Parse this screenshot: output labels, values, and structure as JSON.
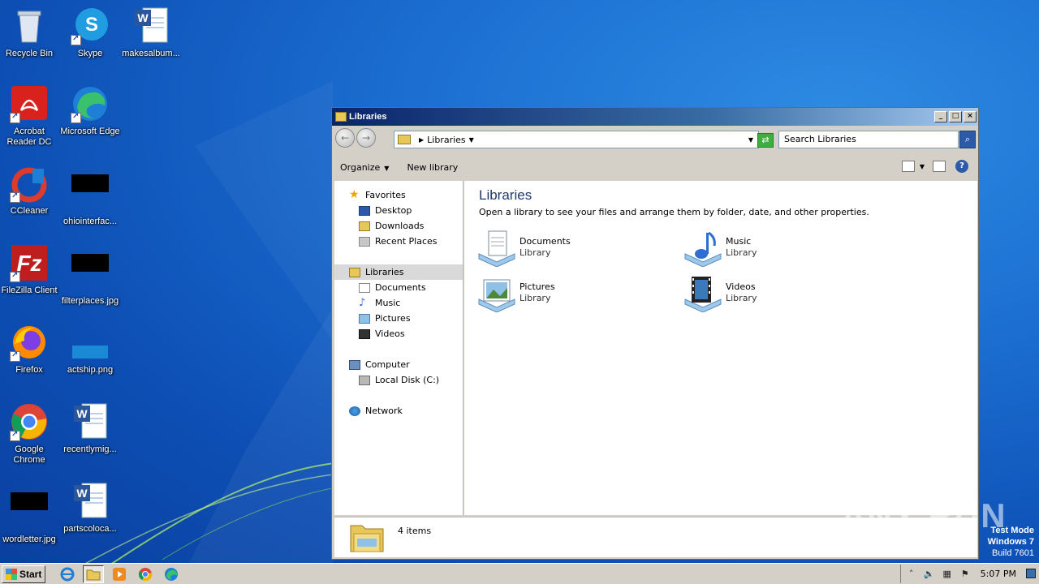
{
  "desktop": {
    "icons": [
      {
        "label": "Recycle Bin"
      },
      {
        "label": "Skype"
      },
      {
        "label": "makesalbum..."
      },
      {
        "label": "Acrobat Reader DC"
      },
      {
        "label": "Microsoft Edge"
      },
      {
        "label": "CCleaner"
      },
      {
        "label": "ohiointerfac..."
      },
      {
        "label": "FileZilla Client"
      },
      {
        "label": "filterplaces.jpg"
      },
      {
        "label": "Firefox"
      },
      {
        "label": "actship.png"
      },
      {
        "label": "Google Chrome"
      },
      {
        "label": "recentlymig..."
      },
      {
        "label": "wordletter.jpg"
      },
      {
        "label": "partscoloca..."
      }
    ]
  },
  "window": {
    "title": "Libraries",
    "address": {
      "crumb": "Libraries"
    },
    "search": {
      "placeholder": "Search Libraries"
    },
    "toolbar": {
      "organize": "Organize",
      "new_library": "New library"
    },
    "nav": {
      "favorites": "Favorites",
      "desktop": "Desktop",
      "downloads": "Downloads",
      "recent": "Recent Places",
      "libraries": "Libraries",
      "documents": "Documents",
      "music": "Music",
      "pictures": "Pictures",
      "videos": "Videos",
      "computer": "Computer",
      "local_disk": "Local Disk (C:)",
      "network": "Network"
    },
    "content": {
      "heading": "Libraries",
      "description": "Open a library to see your files and arrange them by folder, date, and other properties.",
      "items": [
        {
          "name": "Documents",
          "type": "Library"
        },
        {
          "name": "Music",
          "type": "Library"
        },
        {
          "name": "Pictures",
          "type": "Library"
        },
        {
          "name": "Videos",
          "type": "Library"
        }
      ]
    },
    "status": {
      "count": "4 items"
    }
  },
  "watermark": {
    "text": "ANY RUN"
  },
  "system": {
    "line1": "Test Mode",
    "line2": "Windows 7",
    "line3": "Build 7601"
  },
  "taskbar": {
    "start": "Start",
    "clock": "5:07 PM"
  }
}
